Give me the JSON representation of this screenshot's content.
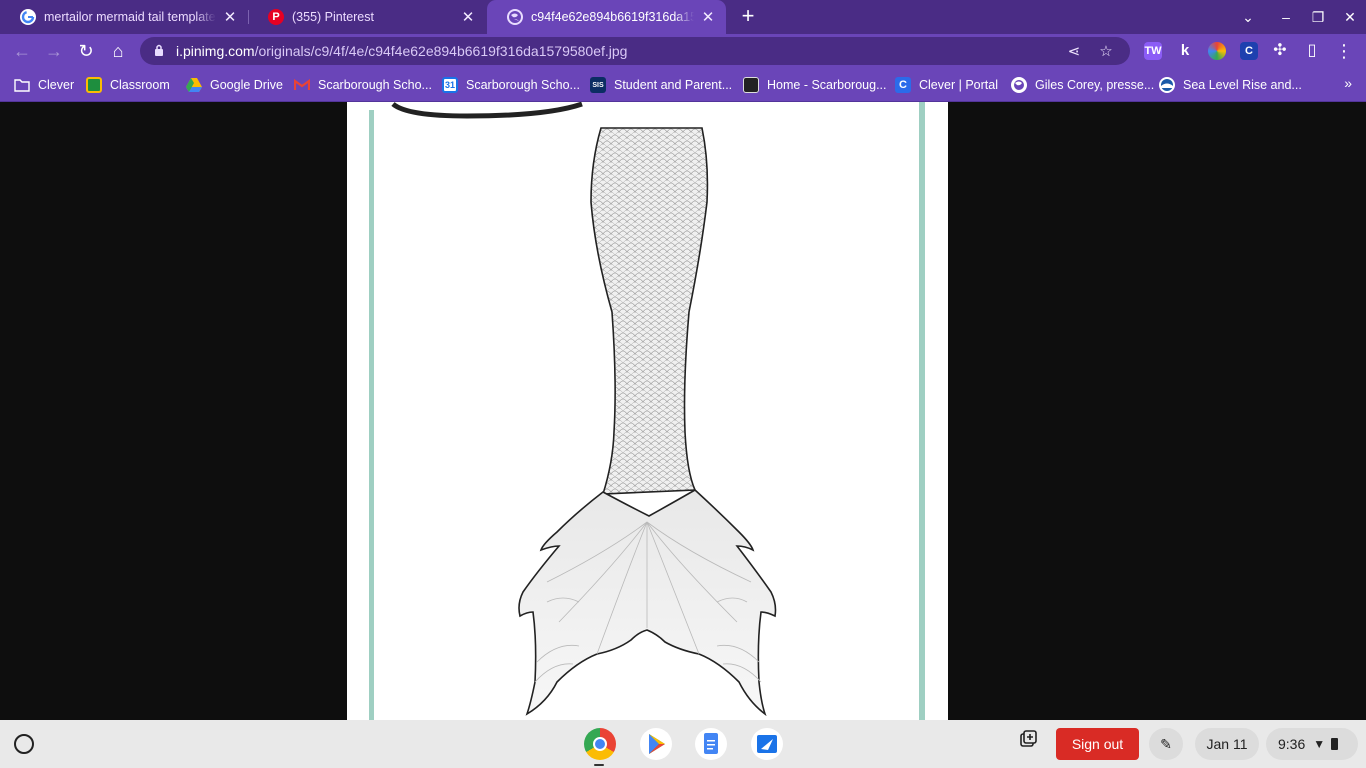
{
  "tabs": [
    {
      "title": "mertailor mermaid tail template",
      "favicon": "google-g-icon",
      "active": false
    },
    {
      "title": "(355) Pinterest",
      "favicon": "pinterest-icon",
      "active": false
    },
    {
      "title": "c94f4e62e894b6619f316da1579580ef.jpg",
      "favicon": "globe-icon",
      "active": true
    }
  ],
  "toolbar": {
    "url_host": "i.pinimg.com",
    "url_path": "/originals/c9/4f/4e/c94f4e62e894b6619f316da1579580ef.jpg"
  },
  "extensions": [
    {
      "name": "tw-extension-icon",
      "label": "TW"
    },
    {
      "name": "kami-extension-icon",
      "label": "k"
    },
    {
      "name": "color-extension-icon",
      "label": ""
    },
    {
      "name": "clever-extension-icon",
      "label": "C"
    }
  ],
  "bookmarks": [
    {
      "label": "Clever",
      "icon": "folder-icon"
    },
    {
      "label": "Classroom",
      "icon": "classroom-icon"
    },
    {
      "label": "Google Drive",
      "icon": "google-drive-icon"
    },
    {
      "label": "Scarborough Scho...",
      "icon": "gmail-icon"
    },
    {
      "label": "Scarborough Scho...",
      "icon": "calendar-icon"
    },
    {
      "label": "Student and Parent...",
      "icon": "sis-icon"
    },
    {
      "label": "Home - Scarboroug...",
      "icon": "school-logo-icon"
    },
    {
      "label": "Clever | Portal",
      "icon": "clever-icon"
    },
    {
      "label": "Giles Corey, presse...",
      "icon": "globe-icon"
    },
    {
      "label": "Sea Level Rise and...",
      "icon": "noaa-icon"
    }
  ],
  "bookmark_badges": {
    "calendar": "31",
    "sis": "SIS",
    "clever": "C"
  },
  "shelf": {
    "apps": [
      "chrome-icon",
      "play-store-icon",
      "google-docs-icon",
      "classroom-share-icon"
    ],
    "sign_out": "Sign out",
    "date": "Jan 11",
    "time": "9:36"
  },
  "colors": {
    "frame": "#4a2c85",
    "toolbar": "#6a45b8",
    "sign_out": "#d92b25",
    "tail_border": "#7fbfae"
  }
}
